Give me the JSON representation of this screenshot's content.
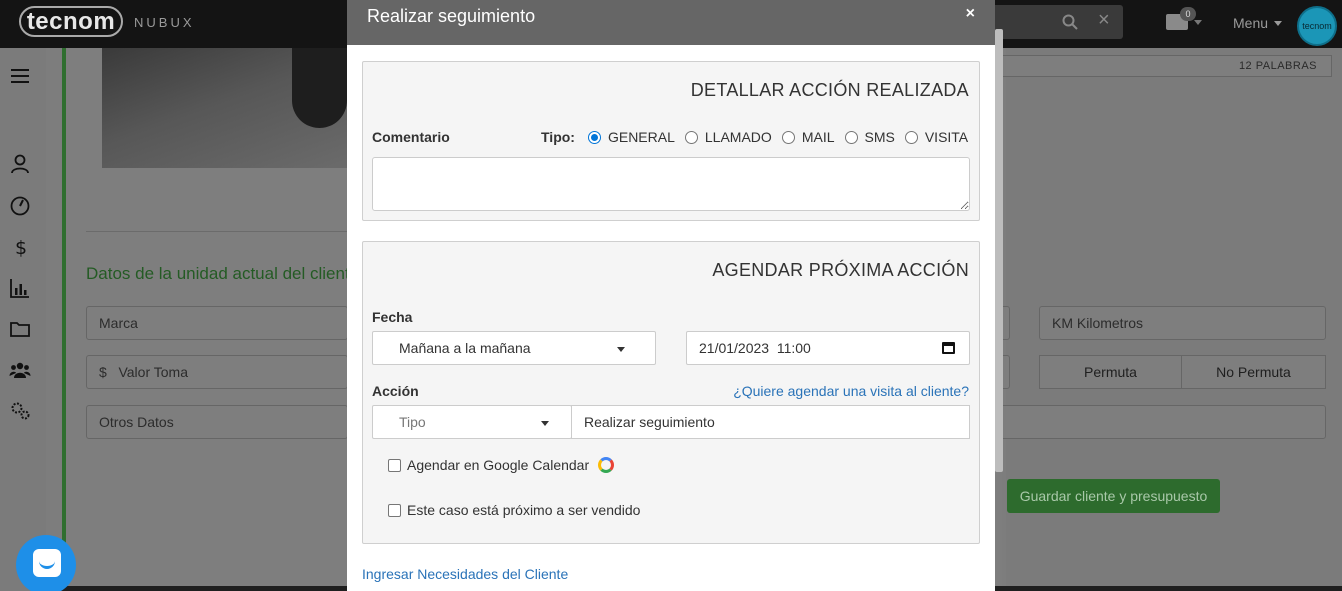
{
  "topbar": {
    "logo": "tecnom",
    "logo_sub": "NUBUX",
    "mail_badge": "0",
    "menu_label": "Menu",
    "avatar_text": "tecnom"
  },
  "background": {
    "word_count": "12 PALABRAS",
    "section_title": "Datos de la unidad actual del cliente",
    "fields": {
      "marca": "Marca",
      "km": "KM Kilometros",
      "valor_currency": "$",
      "valor": "Valor Toma",
      "otros": "Otros Datos"
    },
    "permuta": "Permuta",
    "no_permuta": "No Permuta",
    "save_button": "Guardar cliente y presupuesto"
  },
  "modal": {
    "title": "Realizar seguimiento",
    "close": "×",
    "detail_panel": {
      "title": "DETALLAR ACCIÓN REALIZADA",
      "comment_label": "Comentario",
      "tipo_label": "Tipo:",
      "options": [
        "GENERAL",
        "LLAMADO",
        "MAIL",
        "SMS",
        "VISITA"
      ],
      "selected": "GENERAL",
      "comment_value": ""
    },
    "schedule_panel": {
      "title": "AGENDAR PRÓXIMA ACCIÓN",
      "fecha_label": "Fecha",
      "fecha_select": "Mañana a la mañana",
      "datetime_value": "21/01/2023  11:00",
      "accion_label": "Acción",
      "visit_link": "¿Quiere agendar una visita al cliente?",
      "tipo_select": "Tipo",
      "action_value": "Realizar seguimiento",
      "google_calendar": "Agendar en Google Calendar",
      "near_sale": "Este caso está próximo a ser vendido"
    },
    "needs_link": "Ingresar Necesidades del Cliente"
  },
  "colors": {
    "accent": "#2a73b8",
    "radio": "#0075d8",
    "header": "#666666",
    "green": "#2d6b2d"
  }
}
